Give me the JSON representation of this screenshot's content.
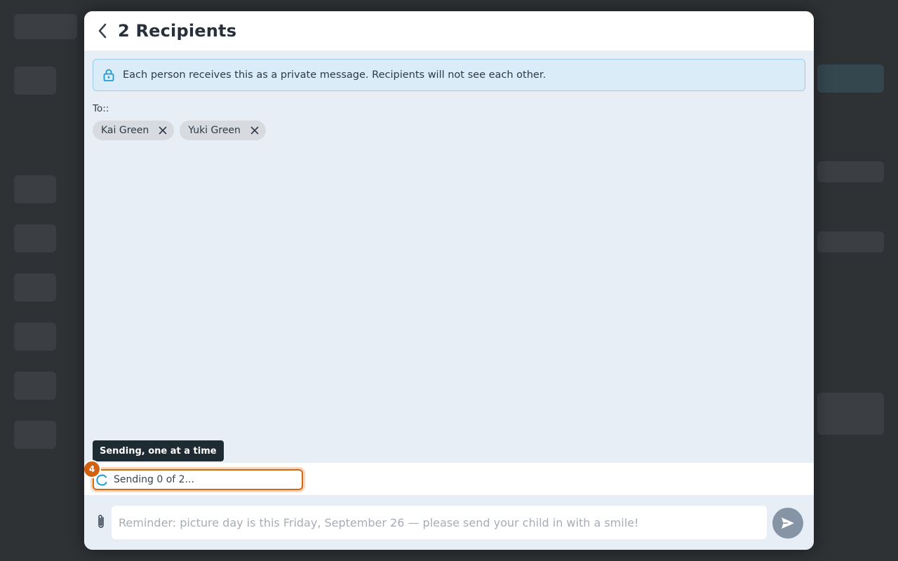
{
  "modal": {
    "title": "2 Recipients"
  },
  "info_banner": {
    "text": "Each person receives this as a private message. Recipients will not see each other."
  },
  "recipients": {
    "label": "To::",
    "chips": [
      {
        "name": "Kai Green"
      },
      {
        "name": "Yuki Green"
      }
    ]
  },
  "status": {
    "tooltip": "Sending, one at a time",
    "step_number": "4",
    "text": "Sending 0 of 2..."
  },
  "composer": {
    "placeholder": "Reminder: picture day is this Friday, September 26 — please send your child in with a smile!"
  },
  "colors": {
    "accent_orange": "#d1600f",
    "info_bg": "#d9ecf7",
    "send_button": "#8794a6"
  },
  "icons": [
    "chevron-left-icon",
    "lock-icon",
    "close-icon",
    "spinner-icon",
    "paperclip-icon",
    "send-icon"
  ]
}
